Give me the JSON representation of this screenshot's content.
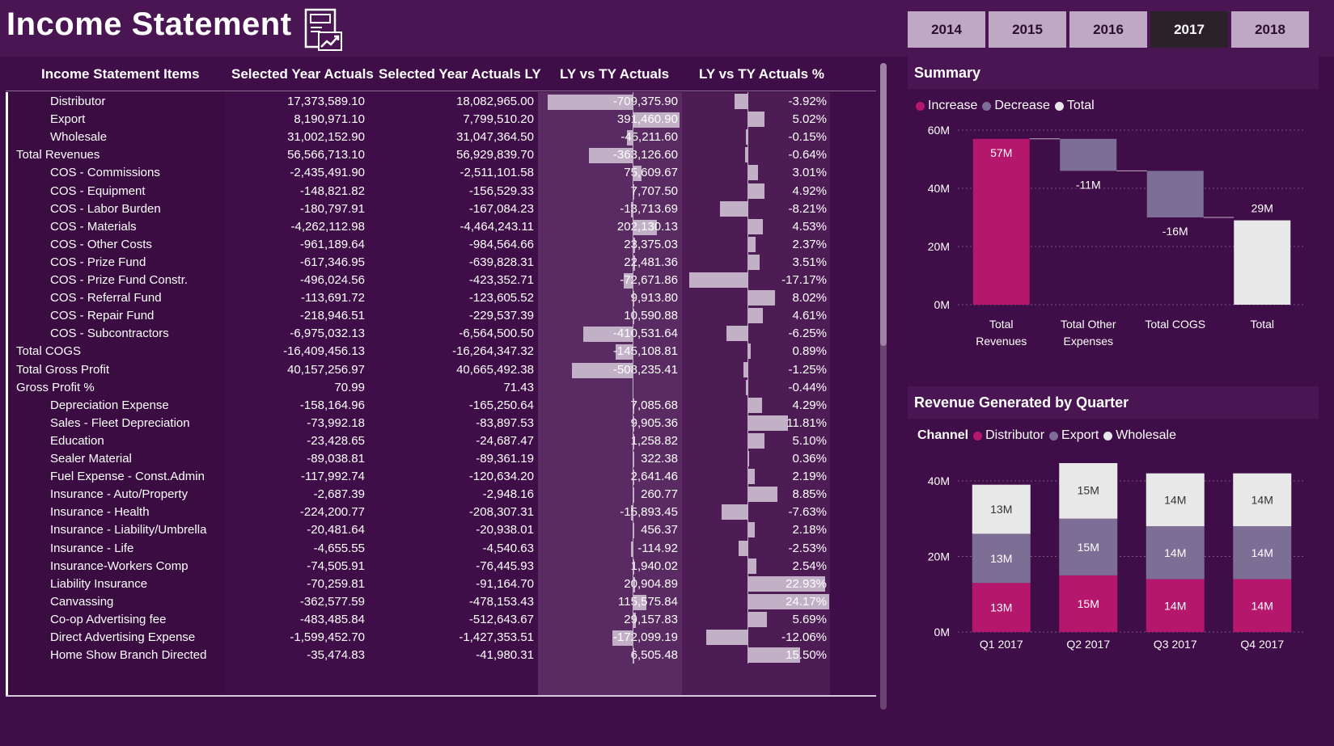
{
  "header": {
    "title": "Income Statement",
    "years": [
      "2014",
      "2015",
      "2016",
      "2017",
      "2018"
    ],
    "active_year": "2017"
  },
  "table": {
    "columns": [
      "Income Statement Items",
      "Selected Year Actuals",
      "Selected Year Actuals LY",
      "LY vs TY Actuals",
      "LY vs TY Actuals %"
    ],
    "rows": [
      {
        "name": "Distributor",
        "indent": true,
        "ty": "17,373,589.10",
        "ly": "18,082,965.00",
        "diff": "-709,375.90",
        "pct": "-3.92%",
        "diff_val": -709375.9,
        "pct_val": -3.92
      },
      {
        "name": "Export",
        "indent": true,
        "ty": "8,190,971.10",
        "ly": "7,799,510.20",
        "diff": "391,460.90",
        "pct": "5.02%",
        "diff_val": 391460.9,
        "pct_val": 5.02
      },
      {
        "name": "Wholesale",
        "indent": true,
        "ty": "31,002,152.90",
        "ly": "31,047,364.50",
        "diff": "-45,211.60",
        "pct": "-0.15%",
        "diff_val": -45211.6,
        "pct_val": -0.15
      },
      {
        "name": "Total Revenues",
        "indent": false,
        "ty": "56,566,713.10",
        "ly": "56,929,839.70",
        "diff": "-363,126.60",
        "pct": "-0.64%",
        "diff_val": -363126.6,
        "pct_val": -0.64
      },
      {
        "name": "COS - Commissions",
        "indent": true,
        "ty": "-2,435,491.90",
        "ly": "-2,511,101.58",
        "diff": "75,609.67",
        "pct": "3.01%",
        "diff_val": 75609.67,
        "pct_val": 3.01
      },
      {
        "name": "COS - Equipment",
        "indent": true,
        "ty": "-148,821.82",
        "ly": "-156,529.33",
        "diff": "7,707.50",
        "pct": "4.92%",
        "diff_val": 7707.5,
        "pct_val": 4.92
      },
      {
        "name": "COS - Labor Burden",
        "indent": true,
        "ty": "-180,797.91",
        "ly": "-167,084.23",
        "diff": "-13,713.69",
        "pct": "-8.21%",
        "diff_val": -13713.69,
        "pct_val": -8.21
      },
      {
        "name": "COS - Materials",
        "indent": true,
        "ty": "-4,262,112.98",
        "ly": "-4,464,243.11",
        "diff": "202,130.13",
        "pct": "4.53%",
        "diff_val": 202130.13,
        "pct_val": 4.53
      },
      {
        "name": "COS - Other Costs",
        "indent": true,
        "ty": "-961,189.64",
        "ly": "-984,564.66",
        "diff": "23,375.03",
        "pct": "2.37%",
        "diff_val": 23375.03,
        "pct_val": 2.37
      },
      {
        "name": "COS - Prize Fund",
        "indent": true,
        "ty": "-617,346.95",
        "ly": "-639,828.31",
        "diff": "22,481.36",
        "pct": "3.51%",
        "diff_val": 22481.36,
        "pct_val": 3.51
      },
      {
        "name": "COS - Prize Fund Constr.",
        "indent": true,
        "ty": "-496,024.56",
        "ly": "-423,352.71",
        "diff": "-72,671.86",
        "pct": "-17.17%",
        "diff_val": -72671.86,
        "pct_val": -17.17
      },
      {
        "name": "COS - Referral Fund",
        "indent": true,
        "ty": "-113,691.72",
        "ly": "-123,605.52",
        "diff": "9,913.80",
        "pct": "8.02%",
        "diff_val": 9913.8,
        "pct_val": 8.02
      },
      {
        "name": "COS - Repair Fund",
        "indent": true,
        "ty": "-218,946.51",
        "ly": "-229,537.39",
        "diff": "10,590.88",
        "pct": "4.61%",
        "diff_val": 10590.88,
        "pct_val": 4.61
      },
      {
        "name": "COS - Subcontractors",
        "indent": true,
        "ty": "-6,975,032.13",
        "ly": "-6,564,500.50",
        "diff": "-410,531.64",
        "pct": "-6.25%",
        "diff_val": -410531.64,
        "pct_val": -6.25
      },
      {
        "name": "Total COGS",
        "indent": false,
        "ty": "-16,409,456.13",
        "ly": "-16,264,347.32",
        "diff": "-145,108.81",
        "pct": "0.89%",
        "diff_val": -145108.81,
        "pct_val": 0.89
      },
      {
        "name": "Total Gross Profit",
        "indent": false,
        "ty": "40,157,256.97",
        "ly": "40,665,492.38",
        "diff": "-508,235.41",
        "pct": "-1.25%",
        "diff_val": -508235.41,
        "pct_val": -1.25
      },
      {
        "name": "Gross Profit %",
        "indent": false,
        "ty": "70.99",
        "ly": "71.43",
        "diff": "",
        "pct": "-0.44%",
        "diff_val": 0,
        "pct_val": -0.44
      },
      {
        "name": "Depreciation Expense",
        "indent": true,
        "ty": "-158,164.96",
        "ly": "-165,250.64",
        "diff": "7,085.68",
        "pct": "4.29%",
        "diff_val": 7085.68,
        "pct_val": 4.29
      },
      {
        "name": "Sales - Fleet Depreciation",
        "indent": true,
        "ty": "-73,992.18",
        "ly": "-83,897.53",
        "diff": "9,905.36",
        "pct": "11.81%",
        "diff_val": 9905.36,
        "pct_val": 11.81
      },
      {
        "name": "Education",
        "indent": true,
        "ty": "-23,428.65",
        "ly": "-24,687.47",
        "diff": "1,258.82",
        "pct": "5.10%",
        "diff_val": 1258.82,
        "pct_val": 5.1
      },
      {
        "name": "Sealer Material",
        "indent": true,
        "ty": "-89,038.81",
        "ly": "-89,361.19",
        "diff": "322.38",
        "pct": "0.36%",
        "diff_val": 322.38,
        "pct_val": 0.36
      },
      {
        "name": "Fuel Expense - Const.Admin",
        "indent": true,
        "ty": "-117,992.74",
        "ly": "-120,634.20",
        "diff": "2,641.46",
        "pct": "2.19%",
        "diff_val": 2641.46,
        "pct_val": 2.19
      },
      {
        "name": "Insurance - Auto/Property",
        "indent": true,
        "ty": "-2,687.39",
        "ly": "-2,948.16",
        "diff": "260.77",
        "pct": "8.85%",
        "diff_val": 260.77,
        "pct_val": 8.85
      },
      {
        "name": "Insurance - Health",
        "indent": true,
        "ty": "-224,200.77",
        "ly": "-208,307.31",
        "diff": "-15,893.45",
        "pct": "-7.63%",
        "diff_val": -15893.45,
        "pct_val": -7.63
      },
      {
        "name": "Insurance - Liability/Umbrella",
        "indent": true,
        "ty": "-20,481.64",
        "ly": "-20,938.01",
        "diff": "456.37",
        "pct": "2.18%",
        "diff_val": 456.37,
        "pct_val": 2.18
      },
      {
        "name": "Insurance - Life",
        "indent": true,
        "ty": "-4,655.55",
        "ly": "-4,540.63",
        "diff": "-114.92",
        "pct": "-2.53%",
        "diff_val": -114.92,
        "pct_val": -2.53
      },
      {
        "name": "Insurance-Workers Comp",
        "indent": true,
        "ty": "-74,505.91",
        "ly": "-76,445.93",
        "diff": "1,940.02",
        "pct": "2.54%",
        "diff_val": 1940.02,
        "pct_val": 2.54
      },
      {
        "name": "Liability Insurance",
        "indent": true,
        "ty": "-70,259.81",
        "ly": "-91,164.70",
        "diff": "20,904.89",
        "pct": "22.93%",
        "diff_val": 20904.89,
        "pct_val": 22.93
      },
      {
        "name": "Canvassing",
        "indent": true,
        "ty": "-362,577.59",
        "ly": "-478,153.43",
        "diff": "115,575.84",
        "pct": "24.17%",
        "diff_val": 115575.84,
        "pct_val": 24.17
      },
      {
        "name": "Co-op Advertising fee",
        "indent": true,
        "ty": "-483,485.84",
        "ly": "-512,643.67",
        "diff": "29,157.83",
        "pct": "5.69%",
        "diff_val": 29157.83,
        "pct_val": 5.69
      },
      {
        "name": "Direct Advertising Expense",
        "indent": true,
        "ty": "-1,599,452.70",
        "ly": "-1,427,353.51",
        "diff": "-172,099.19",
        "pct": "-12.06%",
        "diff_val": -172099.19,
        "pct_val": -12.06
      },
      {
        "name": "Home Show Branch Directed",
        "indent": true,
        "ty": "-35,474.83",
        "ly": "-41,980.31",
        "diff": "6,505.48",
        "pct": "15.50%",
        "diff_val": 6505.48,
        "pct_val": 15.5
      }
    ]
  },
  "summary": {
    "title": "Summary",
    "legend": [
      {
        "label": "Increase",
        "color": "#b5176c"
      },
      {
        "label": "Decrease",
        "color": "#7d6e95"
      },
      {
        "label": "Total",
        "color": "#e8e8e8"
      }
    ]
  },
  "revenue": {
    "title": "Revenue Generated by Quarter",
    "legend_title": "Channel",
    "legend": [
      {
        "label": "Distributor",
        "color": "#b5176c"
      },
      {
        "label": "Export",
        "color": "#7d6e95"
      },
      {
        "label": "Wholesale",
        "color": "#e8e8e8"
      }
    ]
  },
  "chart_data": [
    {
      "type": "bar",
      "subtype": "waterfall",
      "title": "Summary",
      "categories": [
        "Total Revenues",
        "Total Other Expenses",
        "Total COGS",
        "Total"
      ],
      "values": [
        57,
        -11,
        -16,
        29
      ],
      "labels": [
        "57M",
        "-11M",
        "-16M",
        "29M"
      ],
      "ylim": [
        0,
        60
      ],
      "yticks": [
        "0M",
        "20M",
        "40M",
        "60M"
      ],
      "grid": true,
      "legend": "top-left"
    },
    {
      "type": "bar",
      "subtype": "stacked",
      "title": "Revenue Generated by Quarter",
      "categories": [
        "Q1 2017",
        "Q2 2017",
        "Q3 2017",
        "Q4 2017"
      ],
      "series": [
        {
          "name": "Distributor",
          "values": [
            13,
            15,
            14,
            14
          ]
        },
        {
          "name": "Export",
          "values": [
            13,
            15,
            14,
            14
          ]
        },
        {
          "name": "Wholesale",
          "values": [
            13,
            15,
            14,
            14
          ]
        }
      ],
      "labels": [
        [
          "13M",
          "15M",
          "14M",
          "14M"
        ],
        [
          "13M",
          "15M",
          "14M",
          "14M"
        ],
        [
          "13M",
          "15M",
          "14M",
          "14M"
        ]
      ],
      "ylim": [
        0,
        45
      ],
      "yticks": [
        "0M",
        "20M",
        "40M"
      ],
      "grid": true,
      "legend": "top-left"
    }
  ]
}
